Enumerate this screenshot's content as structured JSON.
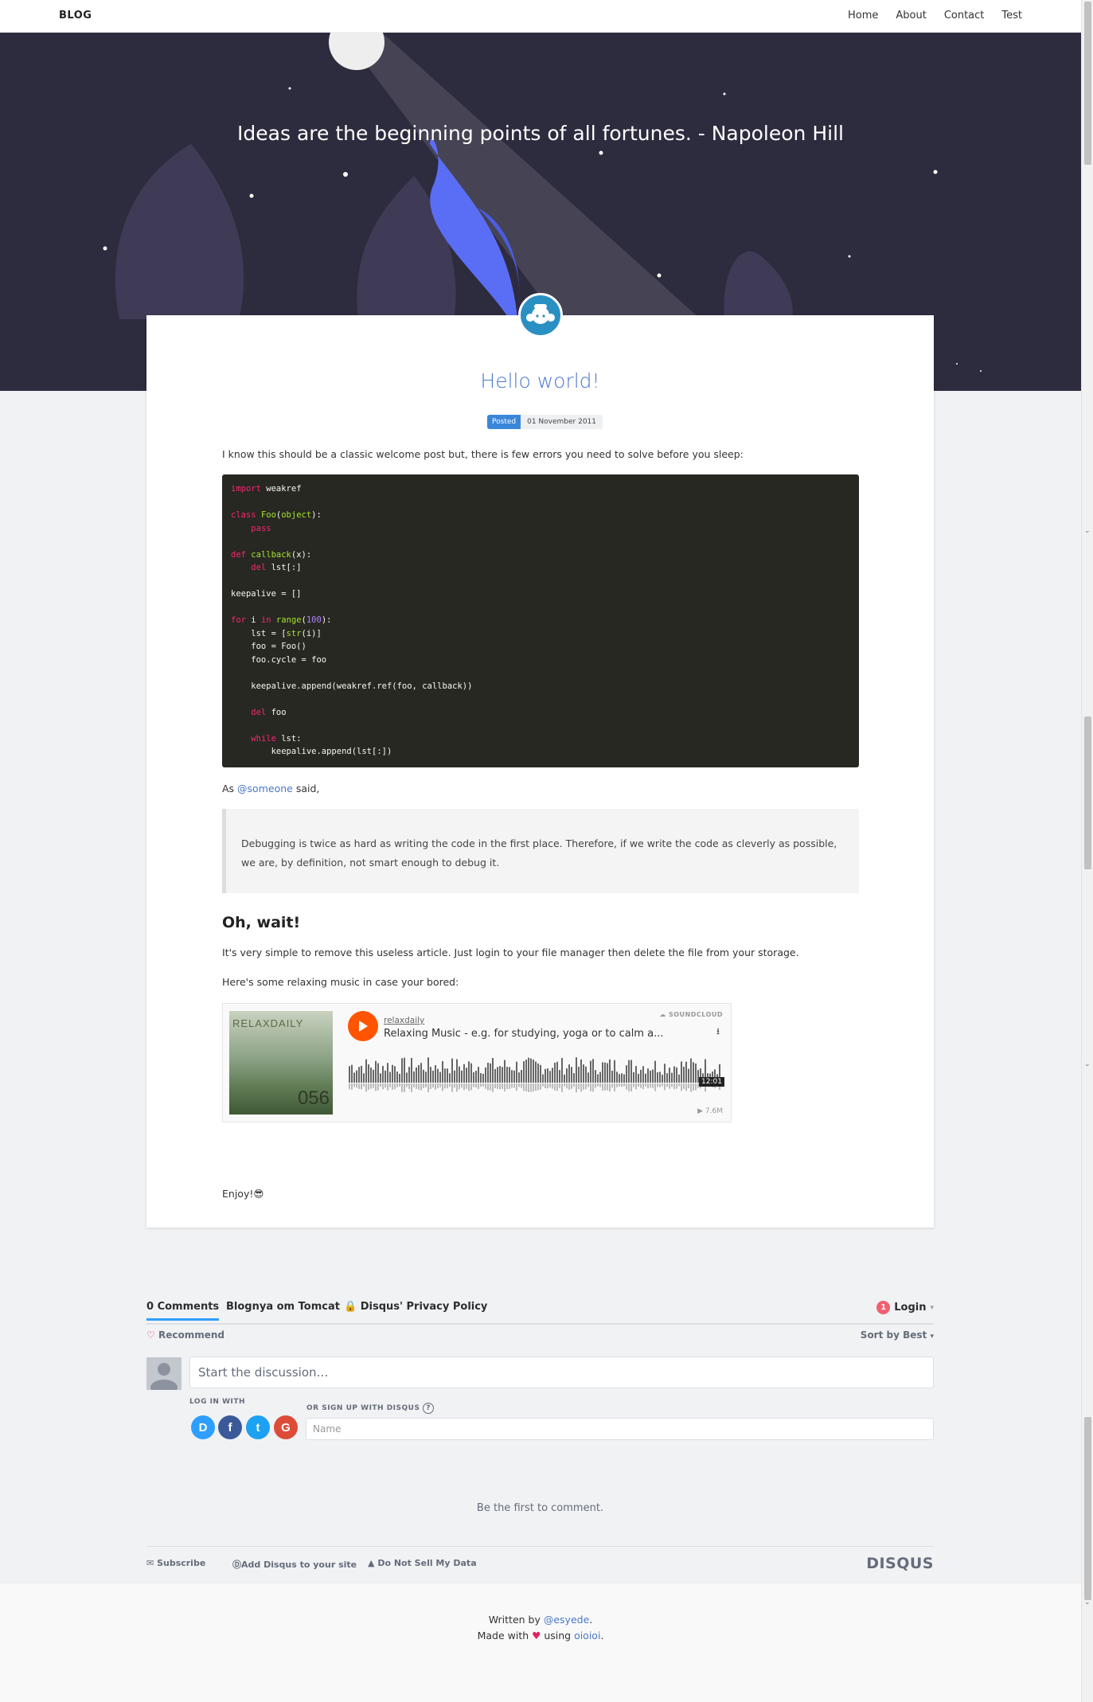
{
  "nav": {
    "brand": "BLOG",
    "links": [
      "Home",
      "About",
      "Contact",
      "Test"
    ]
  },
  "hero": {
    "quote": "Ideas are the beginning points of all fortunes. - Napoleon Hill"
  },
  "post": {
    "title": "Hello world!",
    "tag": "Posted",
    "date": "01 November 2011",
    "intro": "I know this should be a classic welcome post but, there is few errors you need to solve before you sleep:",
    "as_prefix": "As ",
    "mention": "@someone",
    "as_suffix": " said,",
    "quote": "Debugging is twice as hard as writing the code in the first place. Therefore, if we write the code as cleverly as possible, we are, by definition, not smart enough to debug it.",
    "heading": "Oh, wait!",
    "remove_text": "It's very simple to remove this useless article. Just login to your file manager then delete the file from your storage.",
    "music_text": "Here's some relaxing music in case your bored:",
    "enjoy": "Enjoy!😎"
  },
  "soundcloud": {
    "art_label": "RELAXDAILY",
    "art_number": "056",
    "user": "relaxdaily",
    "track": "Relaxing Music - e.g. for studying, yoga or to calm a...",
    "logo": "SOUNDCLOUD",
    "duration": "12:01",
    "plays": "7.6M",
    "accent": "#ff5500"
  },
  "disqus": {
    "tabs": [
      "0 Comments",
      "Blognya om Tomcat",
      "Disqus' Privacy Policy"
    ],
    "login": "Login",
    "notification_count": "1",
    "recommend": "Recommend",
    "sort": "Sort by Best",
    "placeholder": "Start the discussion…",
    "log_in_with": "LOG IN WITH",
    "sign_up": "OR SIGN UP WITH DISQUS",
    "name_placeholder": "Name",
    "first_comment": "Be the first to comment.",
    "footer_links": [
      "Subscribe",
      "Add Disqus to your site",
      "Do Not Sell My Data"
    ],
    "brand": "DISQUS"
  },
  "footer": {
    "written_by": "Written by ",
    "author": "@esyede",
    "made_with": "Made with ",
    "using": " using ",
    "tool": "oioioi"
  }
}
